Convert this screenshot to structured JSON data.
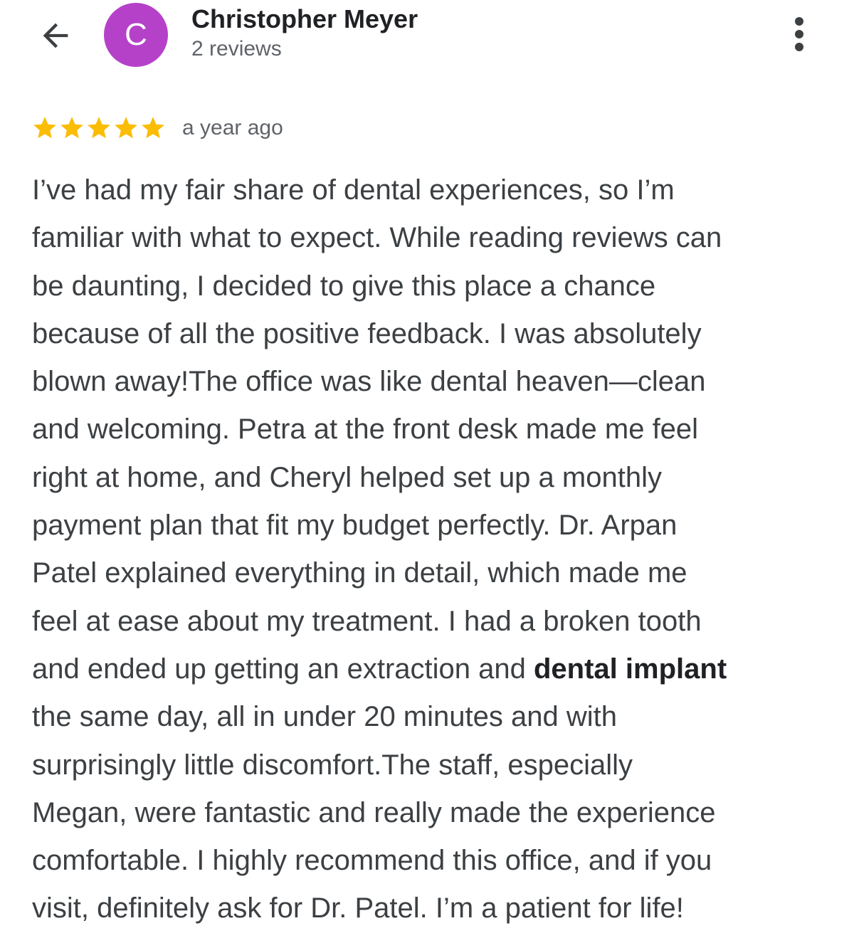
{
  "header": {
    "back_icon": "arrow-back-icon",
    "avatar_initial": "C",
    "avatar_color": "#b541c9",
    "reviewer_name": "Christopher Meyer",
    "review_count": "2 reviews",
    "more_icon": "more-vert-icon"
  },
  "review": {
    "rating": 5,
    "rating_max": 5,
    "star_color": "#fbbc04",
    "time": "a year ago",
    "lines": [
      {
        "text": "I’ve had my fair share of dental experiences, so I’m"
      },
      {
        "text": "familiar with what to expect. While reading reviews can"
      },
      {
        "text": "be daunting, I decided to give this place a chance"
      },
      {
        "text": "because of all the positive feedback. I was absolutely"
      },
      {
        "text": "blown away!The office was like dental heaven—clean"
      },
      {
        "text": "and welcoming. Petra at the front desk made me feel"
      },
      {
        "text": "right at home, and Cheryl helped set up a monthly"
      },
      {
        "text": "payment plan that fit my budget perfectly. Dr. Arpan"
      },
      {
        "text": "Patel explained everything in detail, which made me"
      },
      {
        "text": "feel at ease about my treatment. I had a broken tooth"
      },
      {
        "text": "and ended up getting an extraction and ",
        "bold": "dental implant"
      },
      {
        "text": "the same day, all in under 20 minutes and with"
      },
      {
        "text": "surprisingly little discomfort.The staff, especially"
      },
      {
        "text": "Megan, were fantastic and really made the experience"
      },
      {
        "text": "comfortable. I highly recommend this office, and if you"
      },
      {
        "text": "visit, definitely ask for Dr. Patel. I’m a patient for life!"
      }
    ]
  }
}
